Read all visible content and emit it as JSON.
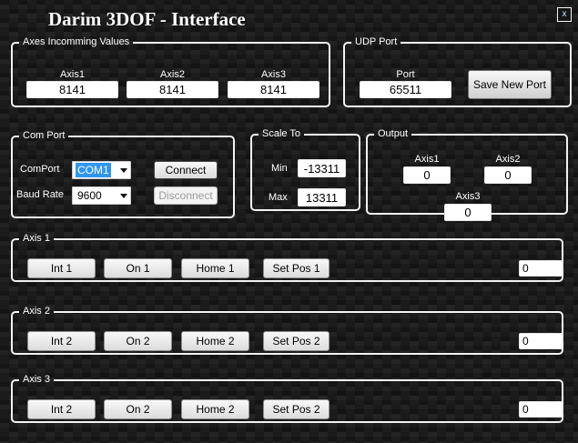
{
  "window": {
    "title": "Darim 3DOF - Interface",
    "close_label": "x"
  },
  "colors": {
    "selection_blue": "#2f96ef",
    "group_border": "#f2f2f2",
    "background_base": "#131313"
  },
  "axes_incoming": {
    "legend": "Axes Incomming Values",
    "fields": [
      {
        "label": "Axis1",
        "value": "8141"
      },
      {
        "label": "Axis2",
        "value": "8141"
      },
      {
        "label": "Axis3",
        "value": "8141"
      }
    ]
  },
  "udp_port": {
    "legend": "UDP Port",
    "port_label": "Port",
    "port_value": "65511",
    "save_button": "Save New Port"
  },
  "com_port": {
    "legend": "Com Port",
    "comport_label": "ComPort",
    "comport_value": "COM1",
    "baud_label": "Baud Rate",
    "baud_value": "9600",
    "connect_button": "Connect",
    "disconnect_button": "Disconnect"
  },
  "scale_to": {
    "legend": "Scale To",
    "min_label": "Min",
    "min_value": "-13311",
    "max_label": "Max",
    "max_value": "13311"
  },
  "output": {
    "legend": "Output",
    "fields": [
      {
        "label": "Axis1",
        "value": "0"
      },
      {
        "label": "Axis2",
        "value": "0"
      },
      {
        "label": "Axis3",
        "value": "0"
      }
    ]
  },
  "axis_groups": [
    {
      "legend": "Axis 1",
      "buttons": [
        "Int 1",
        "On 1",
        "Home 1",
        "Set Pos 1"
      ],
      "value": "0"
    },
    {
      "legend": "Axis 2",
      "buttons": [
        "Int 2",
        "On 2",
        "Home 2",
        "Set Pos 2"
      ],
      "value": "0"
    },
    {
      "legend": "Axis 3",
      "buttons": [
        "Int 2",
        "On 2",
        "Home 2",
        "Set Pos 2"
      ],
      "value": "0"
    }
  ]
}
